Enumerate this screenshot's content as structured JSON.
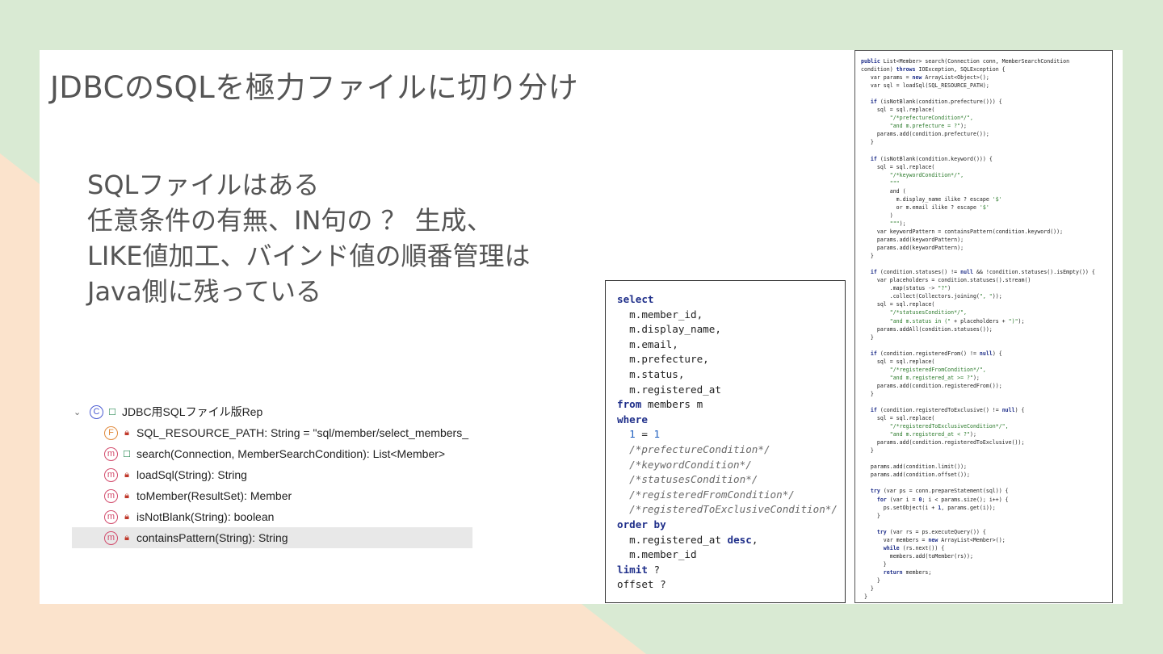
{
  "slide": {
    "title": "JDBCのSQLを極力ファイルに切り分け",
    "body_lines": [
      "SQLファイルはある",
      "任意条件の有無、IN句の ？ 生成、",
      "LIKE値加工、バインド値の順番管理は",
      "Java側に残っている"
    ]
  },
  "outline": {
    "class_name": "JDBC用SQLファイル版Rep",
    "members": [
      {
        "label": "SQL_RESOURCE_PATH: String = \"sql/member/select_members_",
        "kind": "field",
        "visibility": "private"
      },
      {
        "label": "search(Connection, MemberSearchCondition): List<Member>",
        "kind": "method",
        "visibility": "public"
      },
      {
        "label": "loadSql(String): String",
        "kind": "static-method",
        "visibility": "private"
      },
      {
        "label": "toMember(ResultSet): Member",
        "kind": "static-method",
        "visibility": "private"
      },
      {
        "label": "isNotBlank(String): boolean",
        "kind": "static-method",
        "visibility": "private"
      },
      {
        "label": "containsPattern(String): String",
        "kind": "static-method",
        "visibility": "private",
        "selected": true
      }
    ]
  },
  "sql_code": [
    [
      {
        "t": "kw",
        "v": "select"
      }
    ],
    [
      {
        "t": "",
        "v": "  m.member_id,"
      }
    ],
    [
      {
        "t": "",
        "v": "  m.display_name,"
      }
    ],
    [
      {
        "t": "",
        "v": "  m.email,"
      }
    ],
    [
      {
        "t": "",
        "v": "  m.prefecture,"
      }
    ],
    [
      {
        "t": "",
        "v": "  m.status,"
      }
    ],
    [
      {
        "t": "",
        "v": "  m.registered_at"
      }
    ],
    [
      {
        "t": "kw",
        "v": "from"
      },
      {
        "t": "",
        "v": " members m"
      }
    ],
    [
      {
        "t": "kw",
        "v": "where"
      }
    ],
    [
      {
        "t": "",
        "v": "  "
      },
      {
        "t": "num",
        "v": "1"
      },
      {
        "t": "",
        "v": " = "
      },
      {
        "t": "num",
        "v": "1"
      }
    ],
    [
      {
        "t": "cm",
        "v": "  /*prefectureCondition*/"
      }
    ],
    [
      {
        "t": "cm",
        "v": "  /*keywordCondition*/"
      }
    ],
    [
      {
        "t": "cm",
        "v": "  /*statusesCondition*/"
      }
    ],
    [
      {
        "t": "cm",
        "v": "  /*registeredFromCondition*/"
      }
    ],
    [
      {
        "t": "cm",
        "v": "  /*registeredToExclusiveCondition*/"
      }
    ],
    [
      {
        "t": "kw",
        "v": "order by"
      }
    ],
    [
      {
        "t": "",
        "v": "  m.registered_at "
      },
      {
        "t": "kw",
        "v": "desc"
      },
      {
        "t": "",
        "v": ","
      }
    ],
    [
      {
        "t": "",
        "v": "  m.member_id"
      }
    ],
    [
      {
        "t": "kw",
        "v": "limit"
      },
      {
        "t": "",
        "v": " ?"
      }
    ],
    [
      {
        "t": "",
        "v": "offset ?"
      }
    ]
  ],
  "java_code": [
    [
      {
        "t": "jk",
        "v": "public"
      },
      {
        "t": "",
        "v": " List<Member> search(Connection conn, MemberSearchCondition"
      }
    ],
    [
      {
        "t": "",
        "v": "condition) "
      },
      {
        "t": "jk",
        "v": "throws"
      },
      {
        "t": "",
        "v": " IOException, SQLException {"
      }
    ],
    [
      {
        "t": "",
        "v": "   var params = "
      },
      {
        "t": "jk",
        "v": "new"
      },
      {
        "t": "",
        "v": " ArrayList<Object>();"
      }
    ],
    [
      {
        "t": "",
        "v": "   var sql = loadSql(SQL_RESOURCE_PATH);"
      }
    ],
    [
      {
        "t": "",
        "v": ""
      }
    ],
    [
      {
        "t": "",
        "v": "   "
      },
      {
        "t": "jk",
        "v": "if"
      },
      {
        "t": "",
        "v": " (isNotBlank(condition.prefecture())) {"
      }
    ],
    [
      {
        "t": "",
        "v": "     sql = sql.replace("
      }
    ],
    [
      {
        "t": "js",
        "v": "         \"/*prefectureCondition*/\","
      }
    ],
    [
      {
        "t": "js",
        "v": "         \"and m.prefecture = ?\""
      },
      {
        "t": "",
        "v": ");"
      }
    ],
    [
      {
        "t": "",
        "v": "     params.add(condition.prefecture());"
      }
    ],
    [
      {
        "t": "",
        "v": "   }"
      }
    ],
    [
      {
        "t": "",
        "v": ""
      }
    ],
    [
      {
        "t": "",
        "v": "   "
      },
      {
        "t": "jk",
        "v": "if"
      },
      {
        "t": "",
        "v": " (isNotBlank(condition.keyword())) {"
      }
    ],
    [
      {
        "t": "",
        "v": "     sql = sql.replace("
      }
    ],
    [
      {
        "t": "js",
        "v": "         \"/*keywordCondition*/\","
      }
    ],
    [
      {
        "t": "js",
        "v": "         \"\"\""
      }
    ],
    [
      {
        "t": "",
        "v": "         and ("
      }
    ],
    [
      {
        "t": "",
        "v": "           m.display_name ilike ? escape "
      },
      {
        "t": "js",
        "v": "'$'"
      }
    ],
    [
      {
        "t": "",
        "v": "           or m.email ilike ? escape "
      },
      {
        "t": "js",
        "v": "'$'"
      }
    ],
    [
      {
        "t": "",
        "v": "         )"
      }
    ],
    [
      {
        "t": "js",
        "v": "         \"\"\""
      },
      {
        "t": "",
        "v": ");"
      }
    ],
    [
      {
        "t": "",
        "v": "     var keywordPattern = containsPattern(condition.keyword());"
      }
    ],
    [
      {
        "t": "",
        "v": "     params.add(keywordPattern);"
      }
    ],
    [
      {
        "t": "",
        "v": "     params.add(keywordPattern);"
      }
    ],
    [
      {
        "t": "",
        "v": "   }"
      }
    ],
    [
      {
        "t": "",
        "v": ""
      }
    ],
    [
      {
        "t": "",
        "v": "   "
      },
      {
        "t": "jk",
        "v": "if"
      },
      {
        "t": "",
        "v": " (condition.statuses() != "
      },
      {
        "t": "jk",
        "v": "null"
      },
      {
        "t": "",
        "v": " && !condition.statuses().isEmpty()) {"
      }
    ],
    [
      {
        "t": "",
        "v": "     var placeholders = condition.statuses().stream()"
      }
    ],
    [
      {
        "t": "",
        "v": "         .map(status -> "
      },
      {
        "t": "js",
        "v": "\"?\""
      },
      {
        "t": "",
        "v": ")"
      }
    ],
    [
      {
        "t": "",
        "v": "         .collect(Collectors.joining("
      },
      {
        "t": "js",
        "v": "\", \""
      },
      {
        "t": "",
        "v": "));"
      }
    ],
    [
      {
        "t": "",
        "v": "     sql = sql.replace("
      }
    ],
    [
      {
        "t": "js",
        "v": "         \"/*statusesCondition*/\","
      }
    ],
    [
      {
        "t": "js",
        "v": "         \"and m.status in (\""
      },
      {
        "t": "",
        "v": " + placeholders + "
      },
      {
        "t": "js",
        "v": "\")\""
      },
      {
        "t": "",
        "v": ");"
      }
    ],
    [
      {
        "t": "",
        "v": "     params.addAll(condition.statuses());"
      }
    ],
    [
      {
        "t": "",
        "v": "   }"
      }
    ],
    [
      {
        "t": "",
        "v": ""
      }
    ],
    [
      {
        "t": "",
        "v": "   "
      },
      {
        "t": "jk",
        "v": "if"
      },
      {
        "t": "",
        "v": " (condition.registeredFrom() != "
      },
      {
        "t": "jk",
        "v": "null"
      },
      {
        "t": "",
        "v": ") {"
      }
    ],
    [
      {
        "t": "",
        "v": "     sql = sql.replace("
      }
    ],
    [
      {
        "t": "js",
        "v": "         \"/*registeredFromCondition*/\","
      }
    ],
    [
      {
        "t": "js",
        "v": "         \"and m.registered_at >= ?\""
      },
      {
        "t": "",
        "v": ");"
      }
    ],
    [
      {
        "t": "",
        "v": "     params.add(condition.registeredFrom());"
      }
    ],
    [
      {
        "t": "",
        "v": "   }"
      }
    ],
    [
      {
        "t": "",
        "v": ""
      }
    ],
    [
      {
        "t": "",
        "v": "   "
      },
      {
        "t": "jk",
        "v": "if"
      },
      {
        "t": "",
        "v": " (condition.registeredToExclusive() != "
      },
      {
        "t": "jk",
        "v": "null"
      },
      {
        "t": "",
        "v": ") {"
      }
    ],
    [
      {
        "t": "",
        "v": "     sql = sql.replace("
      }
    ],
    [
      {
        "t": "js",
        "v": "         \"/*registeredToExclusiveCondition*/\","
      }
    ],
    [
      {
        "t": "js",
        "v": "         \"and m.registered_at < ?\""
      },
      {
        "t": "",
        "v": ");"
      }
    ],
    [
      {
        "t": "",
        "v": "     params.add(condition.registeredToExclusive());"
      }
    ],
    [
      {
        "t": "",
        "v": "   }"
      }
    ],
    [
      {
        "t": "",
        "v": ""
      }
    ],
    [
      {
        "t": "",
        "v": "   params.add(condition.limit());"
      }
    ],
    [
      {
        "t": "",
        "v": "   params.add(condition.offset());"
      }
    ],
    [
      {
        "t": "",
        "v": ""
      }
    ],
    [
      {
        "t": "",
        "v": "   "
      },
      {
        "t": "jk",
        "v": "try"
      },
      {
        "t": "",
        "v": " (var ps = conn.prepareStatement(sql)) {"
      }
    ],
    [
      {
        "t": "",
        "v": "     "
      },
      {
        "t": "jk",
        "v": "for"
      },
      {
        "t": "",
        "v": " (var i = "
      },
      {
        "t": "jk",
        "v": "0"
      },
      {
        "t": "",
        "v": "; i < params.size(); i++) {"
      }
    ],
    [
      {
        "t": "",
        "v": "       ps.setObject(i + "
      },
      {
        "t": "jk",
        "v": "1"
      },
      {
        "t": "",
        "v": ", params.get(i));"
      }
    ],
    [
      {
        "t": "",
        "v": "     }"
      }
    ],
    [
      {
        "t": "",
        "v": ""
      }
    ],
    [
      {
        "t": "",
        "v": "     "
      },
      {
        "t": "jk",
        "v": "try"
      },
      {
        "t": "",
        "v": " (var rs = ps.executeQuery()) {"
      }
    ],
    [
      {
        "t": "",
        "v": "       var members = "
      },
      {
        "t": "jk",
        "v": "new"
      },
      {
        "t": "",
        "v": " ArrayList<Member>();"
      }
    ],
    [
      {
        "t": "",
        "v": "       "
      },
      {
        "t": "jk",
        "v": "while"
      },
      {
        "t": "",
        "v": " (rs.next()) {"
      }
    ],
    [
      {
        "t": "",
        "v": "         members.add(toMember(rs));"
      }
    ],
    [
      {
        "t": "",
        "v": "       }"
      }
    ],
    [
      {
        "t": "",
        "v": "       "
      },
      {
        "t": "jk",
        "v": "return"
      },
      {
        "t": "",
        "v": " members;"
      }
    ],
    [
      {
        "t": "",
        "v": "     }"
      }
    ],
    [
      {
        "t": "",
        "v": "   }"
      }
    ],
    [
      {
        "t": "",
        "v": " }"
      }
    ]
  ],
  "colors": {
    "background": "#d9ead3",
    "accent_shape": "#fbe3cc",
    "keyword": "#1f2f8a",
    "string": "#2a7a2a"
  }
}
